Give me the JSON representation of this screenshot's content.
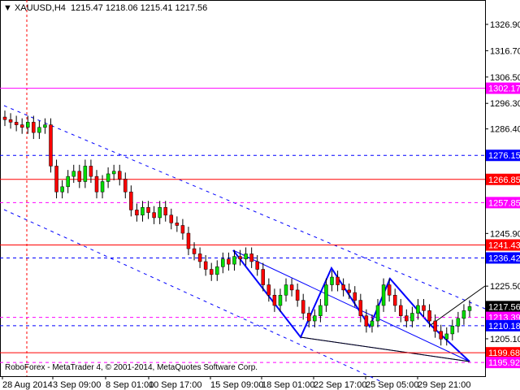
{
  "header": {
    "arrow_icon": "triangle-down-icon",
    "symbol": "XAUUSD,H4",
    "ohlc": "1215.47 1218.06 1215.41 1217.56"
  },
  "copyright": "RoboForex - MetaTrader 4, © 2001-2014, MetaQuotes Software Corp.",
  "chart_data": {
    "type": "candlestick",
    "title": "XAUUSD,H4",
    "ylim": [
      1193,
      1336
    ],
    "y_ticks": [
      "1326.90",
      "1316.70",
      "1306.50",
      "1296.30",
      "1286.40",
      "1245.90",
      "1225.50",
      "1205.10"
    ],
    "x_ticks": [
      "28 Aug 2014",
      "3 Sep 09:00",
      "8 Sep 01:00",
      "10 Sep 17:00",
      "15 Sep 09:00",
      "18 Sep 01:00",
      "22 Sep 17:00",
      "25 Sep 05:00",
      "29 Sep 21:00"
    ],
    "closes": [
      1290,
      1289,
      1288,
      1287,
      1289,
      1285,
      1287,
      1288,
      1272,
      1262,
      1264,
      1268,
      1270,
      1266,
      1272,
      1268,
      1262,
      1266,
      1269,
      1270,
      1267,
      1262,
      1255,
      1253,
      1256,
      1254,
      1252,
      1256,
      1253,
      1250,
      1249,
      1246,
      1240,
      1238,
      1235,
      1232,
      1230,
      1233,
      1236,
      1234,
      1237,
      1236,
      1238,
      1235,
      1232,
      1226,
      1222,
      1218,
      1222,
      1226,
      1224,
      1220,
      1215,
      1212,
      1214,
      1218,
      1226,
      1229,
      1226,
      1224,
      1223,
      1220,
      1214,
      1210,
      1212,
      1218,
      1226,
      1222,
      1218,
      1214,
      1212,
      1215,
      1218,
      1216,
      1212,
      1208,
      1205,
      1207,
      1210,
      1213,
      1216,
      1217.56
    ],
    "levels": [
      {
        "value": 1302.17,
        "label": "1302.17",
        "color": "#ff00ff",
        "style": "solid"
      },
      {
        "value": 1276.15,
        "label": "1276.15",
        "color": "#0000ff",
        "style": "dashed"
      },
      {
        "value": 1266.85,
        "label": "1266.85",
        "color": "#ff0000",
        "style": "solid"
      },
      {
        "value": 1257.85,
        "label": "1257.85",
        "color": "#ff00ff",
        "style": "dashed"
      },
      {
        "value": 1241.43,
        "label": "1241.43",
        "color": "#ff0000",
        "style": "solid"
      },
      {
        "value": 1236.42,
        "label": "1236.42",
        "color": "#0000ff",
        "style": "dashed"
      },
      {
        "value": 1217.56,
        "label": "1217.56",
        "color": "#000000",
        "style": "none"
      },
      {
        "value": 1213.39,
        "label": "1213.39",
        "color": "#ff00ff",
        "style": "dashed"
      },
      {
        "value": 1210.18,
        "label": "1210.18",
        "color": "#0000ff",
        "style": "dashed"
      },
      {
        "value": 1199.68,
        "label": "1199.68",
        "color": "#ff0000",
        "style": "solid"
      },
      {
        "value": 1195.92,
        "label": "1195.92",
        "color": "#ff00ff",
        "style": "dashed"
      }
    ],
    "bull_color": "#00dd00",
    "bear_color": "#ff0000"
  }
}
